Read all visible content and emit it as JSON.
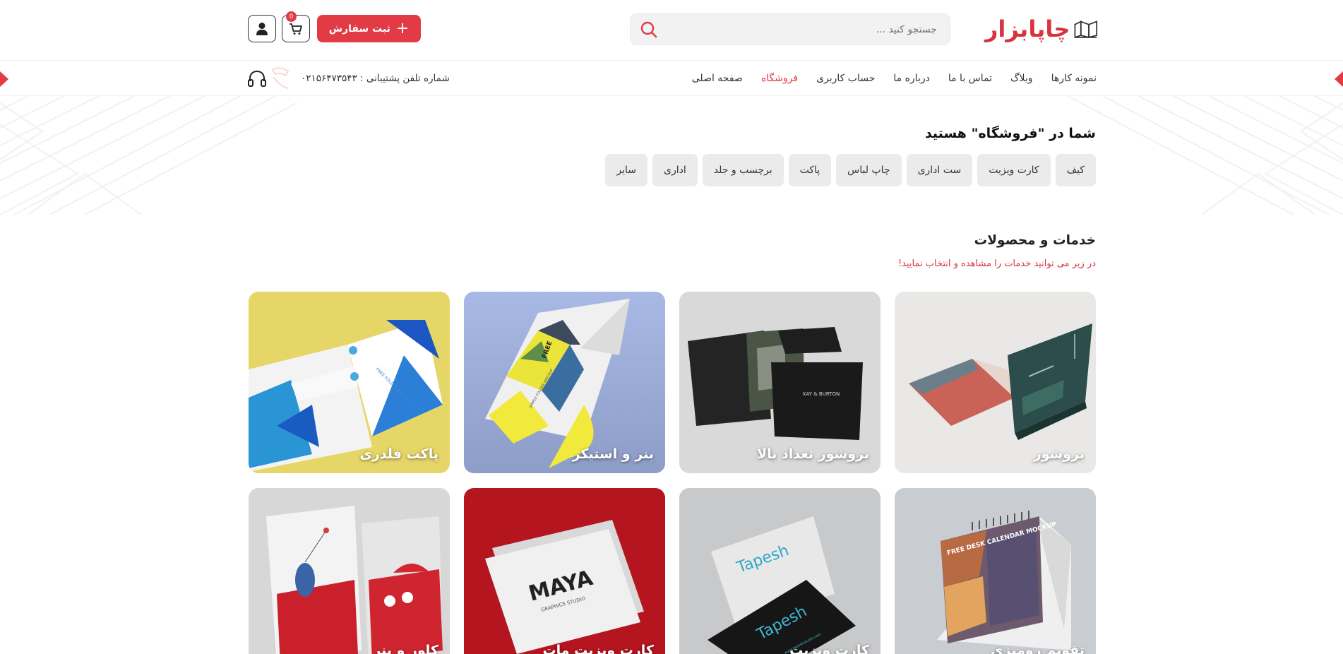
{
  "brand": {
    "name": "چاپابزار",
    "accent": "#e23b46"
  },
  "search": {
    "placeholder": "جستجو کنید ..."
  },
  "header": {
    "order_label": "ثبت سفارش",
    "cart_count": "0"
  },
  "nav": {
    "items": [
      {
        "label": "صفحه اصلی",
        "active": false
      },
      {
        "label": "فروشگاه",
        "active": true
      },
      {
        "label": "حساب کاربری",
        "active": false
      },
      {
        "label": "درباره ما",
        "active": false
      },
      {
        "label": "تماس با ما",
        "active": false
      },
      {
        "label": "وبلاگ",
        "active": false
      },
      {
        "label": "نمونه کارها",
        "active": false
      }
    ],
    "support_label": "شماره تلفن پشتیبانی : ۰۲۱۵۶۴۷۳۵۴۳"
  },
  "hero": {
    "title": "شما در \"فروشگاه\" هستید",
    "chips": [
      "سایر",
      "اداری",
      "برچسب و جلد",
      "پاکت",
      "چاپ لباس",
      "ست اداری",
      "کارت ویزیت",
      "کیف"
    ]
  },
  "section": {
    "title": "خدمات و محصولات",
    "subtitle": "در زیر می توانید خدمات را مشاهده و انتخاب نمایید!"
  },
  "products": [
    {
      "label": "بروشور"
    },
    {
      "label": "بروشور تعداد بالا"
    },
    {
      "label": "بنر و استیکر"
    },
    {
      "label": "پاکت فلدری"
    },
    {
      "label": "تقویم رومیزی"
    },
    {
      "label": "کارت ویزیت"
    },
    {
      "label": "کارت ویزیت مات"
    },
    {
      "label": "کاور و بنر"
    }
  ],
  "mockup_text": {
    "brochure_brand": "KAY & BURTON",
    "folder_free": "FREE",
    "folder_caption": "SIMPLE FOLDER MOCKUP",
    "pocket_caption": "FREE FOLDER MOCKUP",
    "calendar_caption": "FREE DESK CALENDAR MOCKUP",
    "card_brand": "Tapesh",
    "card_site": "www.tapeshstudio.com",
    "maya_brand": "MAYA",
    "maya_caption": "GRAPHICS STUDIO"
  }
}
